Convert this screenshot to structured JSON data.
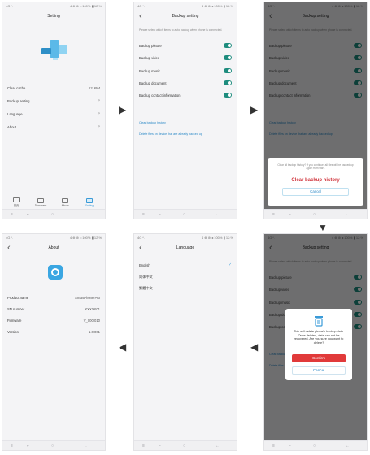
{
  "status": {
    "left": "4G ⁿ.",
    "right": "4 ⊕ ⊛ ◂ 100% ▮ 12:%"
  },
  "settings": {
    "title": "Setting",
    "items": [
      {
        "label": "Clear cache",
        "value": "12.99M"
      },
      {
        "label": "Backup setting",
        "value": ">"
      },
      {
        "label": "Language",
        "value": ">"
      },
      {
        "label": "About",
        "value": ">"
      }
    ],
    "tabs": [
      "首页",
      "Document",
      "Album",
      "Setting"
    ]
  },
  "backup": {
    "title": "Backup setting",
    "hint": "Please select which items to auto backup when phone is connected.",
    "items": [
      "Backup picture",
      "Backup video",
      "Backup music",
      "Backup document",
      "Backup contact information"
    ],
    "clear_link": "Clear backup history",
    "delete_link": "Delete files on device that are already backed up"
  },
  "clear_sheet": {
    "question": "Clear all backup history? If you continue, all files will be backed up again from start.",
    "clear_label": "Clear backup history",
    "cancel_label": "Cancel"
  },
  "confirm_dialog": {
    "text": "This will delete phone's backup data. Once deleted, data can not be recovered. Are you sure you want to delete?",
    "confirm_label": "Confirm",
    "cancel_label": "Cancel"
  },
  "language": {
    "title": "Language",
    "items": [
      "English",
      "简体中文",
      "繁體中文"
    ]
  },
  "about": {
    "title": "About",
    "items": [
      {
        "label": "Product name",
        "value": "SmartPhone Pro"
      },
      {
        "label": "SN number",
        "value": "XXXXX01"
      },
      {
        "label": "Firmware",
        "value": "V_000.010"
      },
      {
        "label": "Version",
        "value": "1.0.001"
      }
    ]
  },
  "arrows": [
    "▶",
    "▶",
    "▼",
    "◀",
    "◀"
  ]
}
